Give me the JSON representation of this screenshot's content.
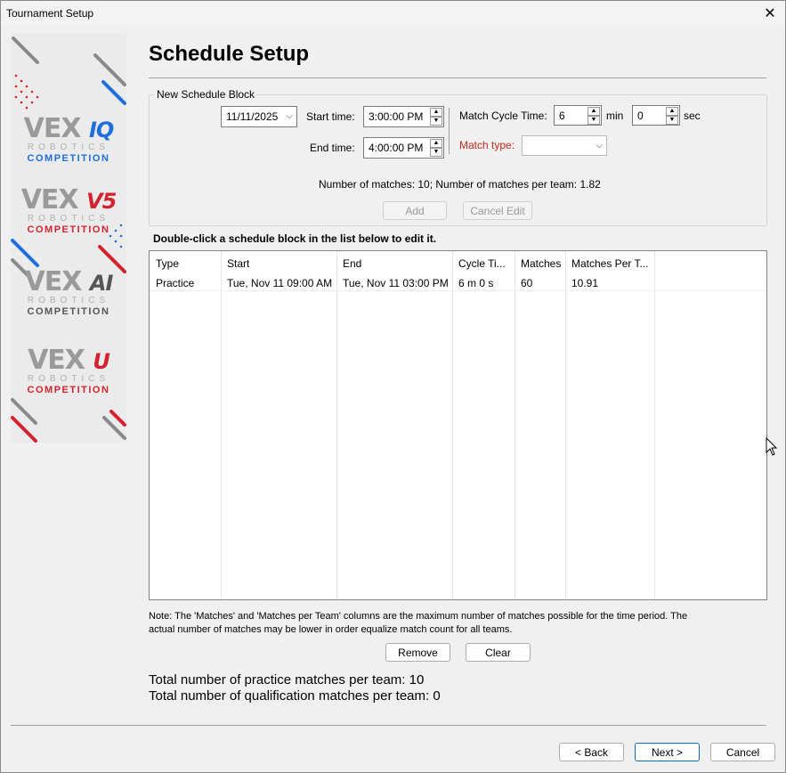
{
  "window": {
    "title": "Tournament Setup"
  },
  "sidebar": {
    "brands": [
      {
        "vex": "VEX",
        "suffix": "IQ",
        "robotics": "ROBOTICS",
        "competition": "COMPETITION"
      },
      {
        "vex": "VEX",
        "suffix": "V5",
        "robotics": "ROBOTICS",
        "competition": "COMPETITION"
      },
      {
        "vex": "VEX",
        "suffix": "AI",
        "robotics": "ROBOTICS",
        "competition": "COMPETITION"
      },
      {
        "vex": "VEX",
        "suffix": "U",
        "robotics": "ROBOTICS",
        "competition": "COMPETITION"
      }
    ]
  },
  "page": {
    "title": "Schedule Setup"
  },
  "block": {
    "label": "New Schedule Block",
    "date": "11/11/2025",
    "start_label": "Start time:",
    "start_value": "3:00:00 PM",
    "end_label": "End time:",
    "end_value": "4:00:00 PM",
    "cycle_label": "Match Cycle Time:",
    "cycle_min": "6",
    "min_unit": "min",
    "cycle_sec": "0",
    "sec_unit": "sec",
    "type_label": "Match type:",
    "type_value": "",
    "summary": "Number of matches: 10; Number of matches per team: 1.82",
    "add": "Add",
    "cancel_edit": "Cancel Edit"
  },
  "list_hint": "Double-click a schedule block in the list below to edit it.",
  "table": {
    "columns": [
      "Type",
      "Start",
      "End",
      "Cycle Ti...",
      "Matches",
      "Matches Per T..."
    ],
    "rows": [
      [
        "Practice",
        "Tue, Nov 11 09:00 AM",
        "Tue, Nov 11 03:00 PM",
        "6 m 0 s",
        "60",
        "10.91"
      ]
    ]
  },
  "note": "Note: The 'Matches' and 'Matches per Team' columns are the maximum number of matches possible for the time period.  The actual number of matches may be lower in order equalize match count for all teams.",
  "buttons": {
    "remove": "Remove",
    "clear": "Clear",
    "back": "< Back",
    "next": "Next >",
    "cancel": "Cancel"
  },
  "totals": {
    "practice": "Total number of practice matches per team: 10",
    "qualification": "Total number of qualification matches per team: 0"
  },
  "colors": {
    "accent": "#d4222f",
    "blue": "#1e6fd9",
    "match_type_label": "#c42b1c"
  }
}
